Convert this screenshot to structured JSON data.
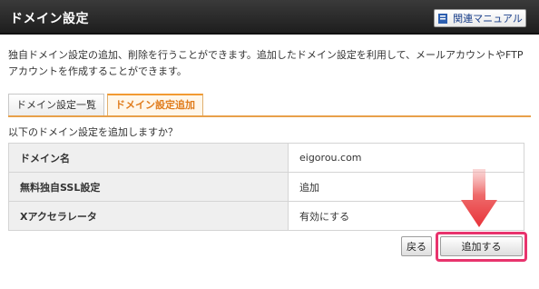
{
  "header": {
    "title": "ドメイン設定",
    "manual_label": "関連マニュアル"
  },
  "description": "独自ドメイン設定の追加、削除を行うことができます。追加したドメイン設定を利用して、メールアカウントやFTPアカウントを作成することができます。",
  "tabs": [
    {
      "label": "ドメイン設定一覧",
      "active": false
    },
    {
      "label": "ドメイン設定追加",
      "active": true
    }
  ],
  "question": "以下のドメイン設定を追加しますか？",
  "rows": [
    {
      "label": "ドメイン名",
      "value": "eigorou.com"
    },
    {
      "label": "無料独自SSL設定",
      "value": "追加"
    },
    {
      "label": "Xアクセラレータ",
      "value": "有効にする"
    }
  ],
  "buttons": {
    "back_label": "戻る",
    "submit_label": "追加する"
  },
  "colors": {
    "accent": "#f29a32",
    "highlight": "#e8336d",
    "arrow": "#e8333a"
  }
}
